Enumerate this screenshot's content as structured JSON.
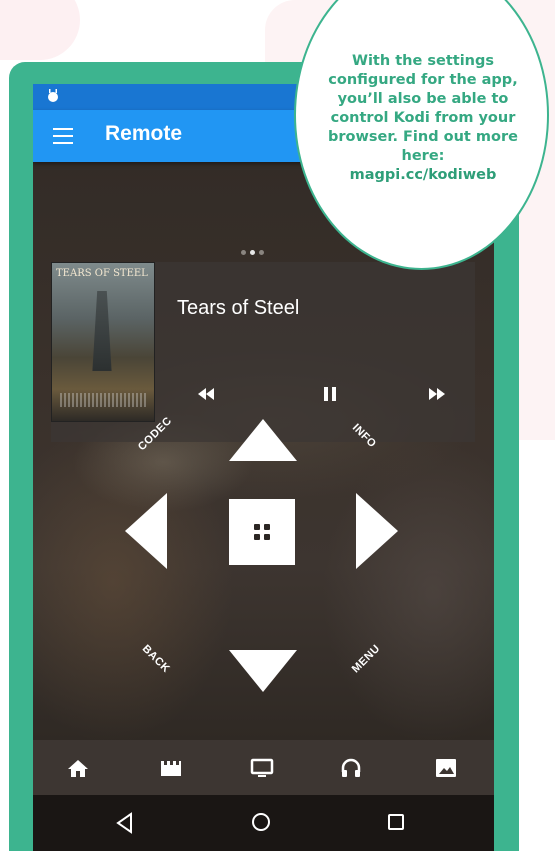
{
  "statusbar": {
    "icon": "android-status-icon"
  },
  "appbar": {
    "title": "Remote",
    "menu_icon": "hamburger-menu-icon"
  },
  "page_indicator": {
    "count": 3,
    "active": 1
  },
  "now_playing": {
    "title": "Tears of Steel",
    "poster_title": "TEARS OF STEEL",
    "controls": [
      "rewind-icon",
      "pause-icon",
      "fast-forward-icon"
    ]
  },
  "remote": {
    "codec_label": "CODEC",
    "info_label": "INFO",
    "back_label": "BACK",
    "menu_label": "MENU"
  },
  "bottom_nav": [
    "home-icon",
    "movies-icon",
    "tv-icon",
    "music-icon",
    "pictures-icon"
  ],
  "android_nav": [
    "back-icon",
    "home-icon",
    "recents-icon"
  ],
  "callout": {
    "text": "With the settings configured for the app, you’ll also be able to control Kodi from your browser. Find out more here:",
    "link": "magpi.cc/kodiweb"
  },
  "colors": {
    "accent": "#3db48f",
    "appbar": "#2196f3",
    "statusbar": "#1976d2"
  }
}
